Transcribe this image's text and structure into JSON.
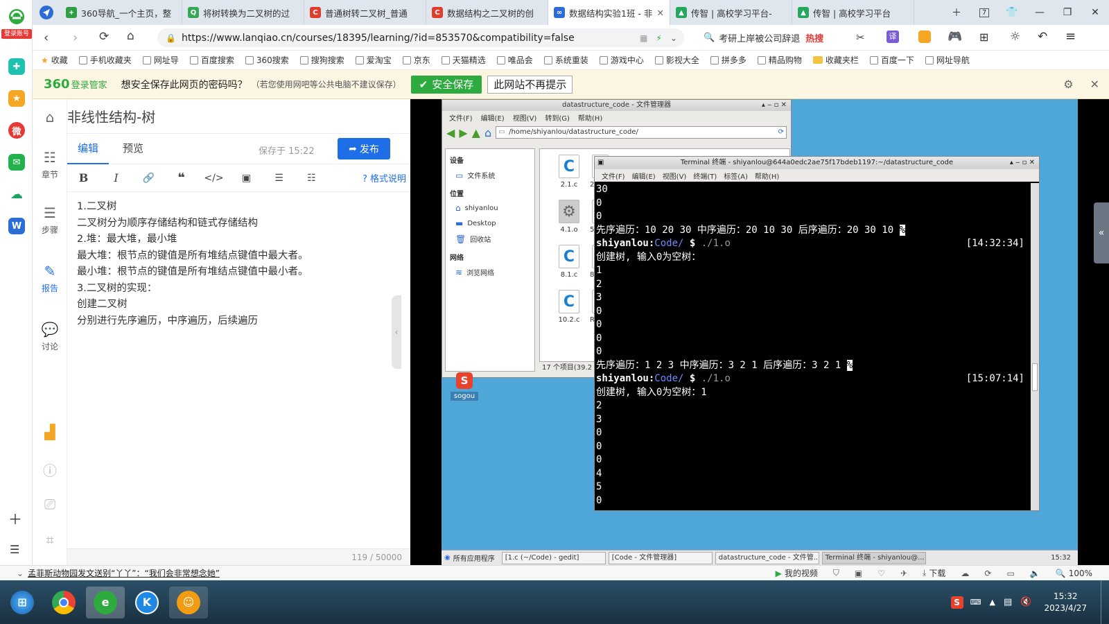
{
  "sidebar360": {
    "login_label": "登录账号"
  },
  "tabs": [
    {
      "title": "360导航_一个主页，整",
      "color": "#2ea043",
      "glyph": "+"
    },
    {
      "title": "将树转换为二叉树的过",
      "color": "#34a853",
      "glyph": "Q"
    },
    {
      "title": "普通树转二叉树_普通",
      "color": "#e03e2d",
      "glyph": "C"
    },
    {
      "title": "数据结构之二叉树的创",
      "color": "#e03e2d",
      "glyph": "C"
    },
    {
      "title": "数据结构实验1班 - 非",
      "color": "#2b6cd6",
      "glyph": "∞"
    },
    {
      "title": "传智 | 高校学习平台-",
      "color": "#26a65b",
      "glyph": "▲"
    },
    {
      "title": "传智 | 高校学习平台",
      "color": "#26a65b",
      "glyph": "▲"
    }
  ],
  "tab_count": "7",
  "address": {
    "url": "https://www.lanqiao.cn/courses/18395/learning/?id=853570&compatibility=false",
    "search_text": "考研上岸被公司辞退",
    "hot_label": "热搜"
  },
  "bookmarks": [
    "收藏",
    "手机收藏夹",
    "网址导",
    "百度搜索",
    "360搜索",
    "搜狗搜索",
    "爱淘宝",
    "京东",
    "天猫精选",
    "唯品会",
    "系统重装",
    "游戏中心",
    "影视大全",
    "拼多多",
    "精品购物",
    "收藏夹栏",
    "百度一下",
    "网址导航"
  ],
  "password_bar": {
    "brand": "360",
    "brand_sub": "登录管家",
    "question": "想安全保存此网页的密码吗？",
    "note": "（若您使用网吧等公共电脑不建议保存）",
    "save_button": "安全保存",
    "never_button": "此网站不再提示"
  },
  "left_nav": [
    {
      "label": "章节"
    },
    {
      "label": "步骤"
    },
    {
      "label": "报告"
    },
    {
      "label": "讨论"
    }
  ],
  "editor": {
    "title": "非线性结构-树",
    "tab_edit": "编辑",
    "tab_preview": "预览",
    "saved": "保存于 15:22",
    "publish": "发布",
    "format_help": "格式说明",
    "lines": [
      "1.二叉树",
      "二叉树分为顺序存储结构和链式存储结构",
      "2.堆：最大堆，最小堆",
      "最大堆：根节点的键值是所有堆结点键值中最大者。",
      "最小堆：根节点的键值是所有堆结点键值中最小者。",
      "3.二叉树的实现：",
      "创建二叉树",
      "分别进行先序遍历，中序遍历，后续遍历"
    ],
    "count": "119 / 50000"
  },
  "file_manager": {
    "title": "datastructure_code - 文件管理器",
    "menu": [
      "文件(F)",
      "编辑(E)",
      "视图(V)",
      "转到(G)",
      "帮助(H)"
    ],
    "path": "/home/shiyanlou/datastructure_code/",
    "sections": [
      {
        "heading": "设备",
        "items": [
          "文件系统"
        ]
      },
      {
        "heading": "位置",
        "items": [
          "shiyanlou",
          "Desktop",
          "回收站"
        ]
      },
      {
        "heading": "网络",
        "items": [
          "浏览网络"
        ]
      }
    ],
    "files": [
      "2.1.c",
      "4.1.o",
      "8.1.c",
      "10.2.c"
    ],
    "partial_files": [
      "2",
      "5",
      "8",
      "READ"
    ],
    "status": "17 个项目(39.2 KB)"
  },
  "desktop_icon": "sogou",
  "terminal": {
    "title": "Terminal 终端 - shiyanlou@644a0edc2ae75f17bdeb1197:~/datastructure_code",
    "menu": [
      "文件(F)",
      "编辑(E)",
      "视图(V)",
      "终端(T)",
      "标签(A)",
      "帮助(H)"
    ],
    "lines": [
      {
        "text": "30"
      },
      {
        "text": "0"
      },
      {
        "text": "0"
      },
      {
        "text": "先序遍历：10 20 30 中序遍历：20 10 30 后序遍历：20 30 10 ",
        "cursor": "%"
      },
      {
        "user": "shiyanlou",
        "sep": ":",
        "cwd": "Code/",
        "dollar": " $ ",
        "cmd": "./1.o",
        "ts": "[14:32:34]"
      },
      {
        "text": "创建树, 输入0为空树："
      },
      {
        "text": "1"
      },
      {
        "text": "2"
      },
      {
        "text": "3"
      },
      {
        "text": "0"
      },
      {
        "text": "0"
      },
      {
        "text": "0"
      },
      {
        "text": "0"
      },
      {
        "text": "先序遍历：1 2 3 中序遍历：3 2 1 后序遍历：3 2 1 ",
        "cursor": "%"
      },
      {
        "user": "shiyanlou",
        "sep": ":",
        "cwd": "Code/",
        "dollar": " $ ",
        "cmd": "./1.o",
        "ts": "[15:07:14]"
      },
      {
        "text": "创建树, 输入0为空树：1"
      },
      {
        "text": "2"
      },
      {
        "text": "3"
      },
      {
        "text": "0"
      },
      {
        "text": "0"
      },
      {
        "text": "0"
      },
      {
        "text": "4"
      },
      {
        "text": "5"
      },
      {
        "text": "0"
      }
    ]
  },
  "remote_taskbar": {
    "apps_label": "所有应用程序",
    "items": [
      "[1.c (~/Code) - gedit]",
      "[Code - 文件管理器]",
      "datastructure_code - 文件管...",
      "Terminal 终端 - shiyanlou@..."
    ],
    "clock": "15:32"
  },
  "status_bar": {
    "news": "孟菲斯动物园发文送别“丫丫”：“我们会非常想念她”",
    "video": "我的视频",
    "download": "下载",
    "zoom": "100%"
  },
  "win_taskbar": {
    "time": "15:32",
    "date": "2023/4/27"
  }
}
